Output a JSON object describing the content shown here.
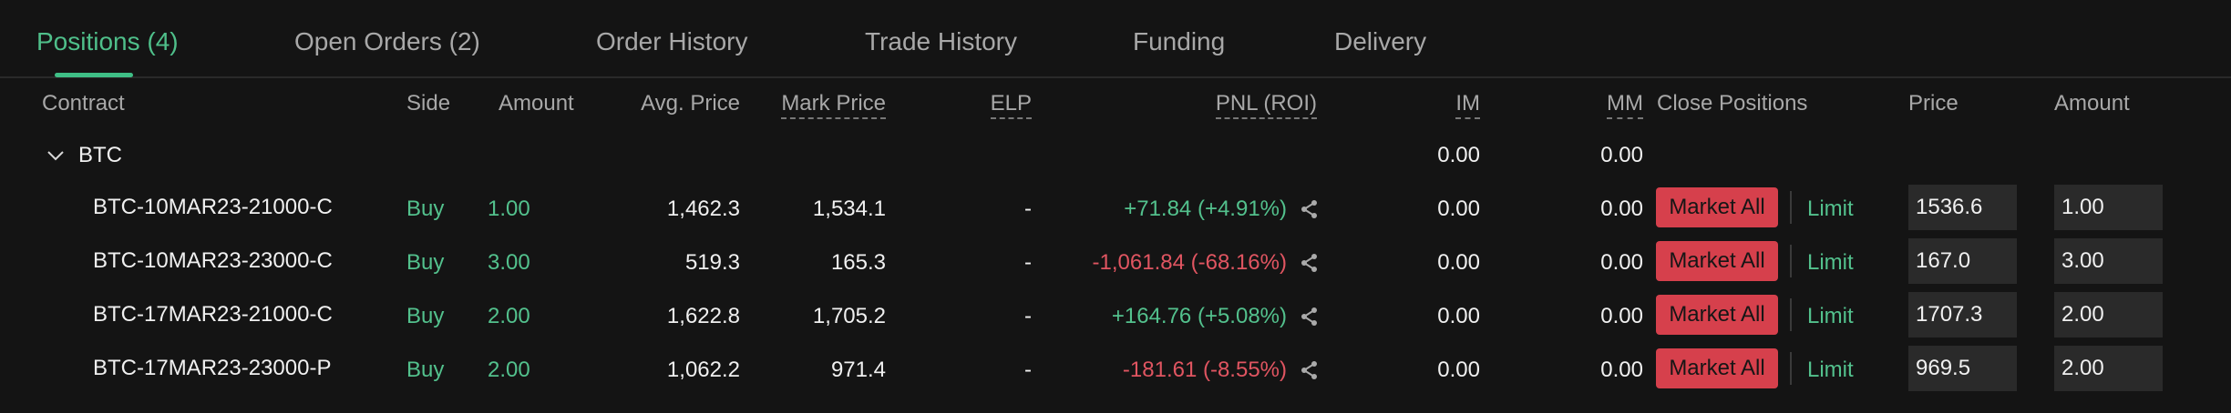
{
  "tabs": [
    {
      "label": "Positions (4)",
      "active": true
    },
    {
      "label": "Open Orders (2)"
    },
    {
      "label": "Order History"
    },
    {
      "label": "Trade History"
    },
    {
      "label": "Funding"
    },
    {
      "label": "Delivery"
    }
  ],
  "columns": {
    "contract": "Contract",
    "side": "Side",
    "amount": "Amount",
    "avg_price": "Avg. Price",
    "mark_price": "Mark Price",
    "elp": "ELP",
    "pnl": "PNL (ROI)",
    "im": "IM",
    "mm": "MM",
    "close_positions": "Close Positions",
    "price": "Price",
    "close_amount": "Amount"
  },
  "group": {
    "name": "BTC",
    "im": "0.00",
    "mm": "0.00",
    "expanded": true
  },
  "rows": [
    {
      "contract": "BTC-10MAR23-21000-C",
      "side": "Buy",
      "amount": "1.00",
      "avg_price": "1,462.3",
      "mark_price": "1,534.1",
      "elp": "-",
      "pnl": "+71.84 (+4.91%)",
      "pnl_sign": "positive",
      "im": "0.00",
      "mm": "0.00",
      "market_label": "Market All",
      "limit_label": "Limit",
      "price_input": "1536.6",
      "amount_input": "1.00"
    },
    {
      "contract": "BTC-10MAR23-23000-C",
      "side": "Buy",
      "amount": "3.00",
      "avg_price": "519.3",
      "mark_price": "165.3",
      "elp": "-",
      "pnl": "-1,061.84 (-68.16%)",
      "pnl_sign": "negative",
      "im": "0.00",
      "mm": "0.00",
      "market_label": "Market All",
      "limit_label": "Limit",
      "price_input": "167.0",
      "amount_input": "3.00"
    },
    {
      "contract": "BTC-17MAR23-21000-C",
      "side": "Buy",
      "amount": "2.00",
      "avg_price": "1,622.8",
      "mark_price": "1,705.2",
      "elp": "-",
      "pnl": "+164.76 (+5.08%)",
      "pnl_sign": "positive",
      "im": "0.00",
      "mm": "0.00",
      "market_label": "Market All",
      "limit_label": "Limit",
      "price_input": "1707.3",
      "amount_input": "2.00"
    },
    {
      "contract": "BTC-17MAR23-23000-P",
      "side": "Buy",
      "amount": "2.00",
      "avg_price": "1,062.2",
      "mark_price": "971.4",
      "elp": "-",
      "pnl": "-181.61 (-8.55%)",
      "pnl_sign": "negative",
      "im": "0.00",
      "mm": "0.00",
      "market_label": "Market All",
      "limit_label": "Limit",
      "price_input": "969.5",
      "amount_input": "2.00"
    }
  ],
  "colors": {
    "positive": "#53c18d",
    "negative": "#e05561",
    "accent": "#3fbf86",
    "button_sell": "#d6404c"
  },
  "icons": {
    "share": "share-icon",
    "collapse": "chevron-down-icon"
  }
}
